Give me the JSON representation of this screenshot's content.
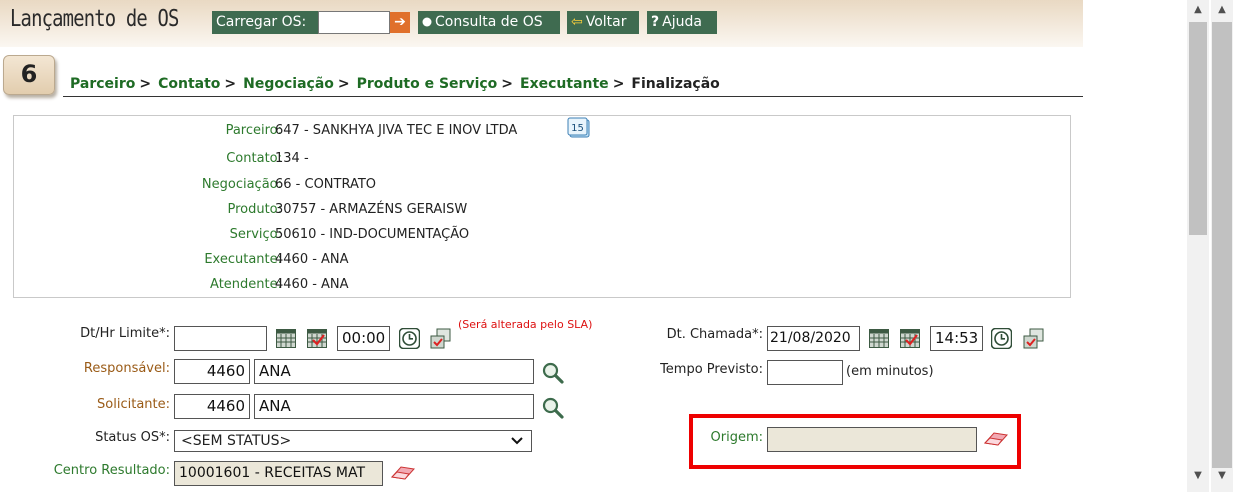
{
  "header": {
    "title": "Lançamento de OS",
    "load_label": "Carregar OS:",
    "load_value": "",
    "consult_label": "Consulta de OS",
    "back_label": "Voltar",
    "help_label": "Ajuda"
  },
  "step": {
    "number": "6"
  },
  "breadcrumb": {
    "items": [
      "Parceiro",
      "Contato",
      "Negociação",
      "Produto e Serviço",
      "Executante"
    ],
    "current": "Finalização",
    "separator": ">"
  },
  "summary": {
    "rows": [
      {
        "label": "Parceiro:",
        "value": "647 - SANKHYA JIVA TEC E INOV LTDA"
      },
      {
        "label": "Contato:",
        "value": "134 -"
      },
      {
        "label": "Negociação:",
        "value": "66 - CONTRATO"
      },
      {
        "label": "Produto:",
        "value": "30757 - ARMAZÉNS GERAISW"
      },
      {
        "label": "Serviço:",
        "value": "50610 - IND-DOCUMENTAÇÃO"
      },
      {
        "label": "Executante:",
        "value": "4460 - ANA"
      },
      {
        "label": "Atendente:",
        "value": "4460 - ANA"
      }
    ],
    "calendar_badge": "15"
  },
  "form": {
    "dt_limite_label": "Dt/Hr Limite*:",
    "dt_limite_value": "",
    "dt_limite_time": "00:00",
    "sla_note": "(Será alterada pelo SLA)",
    "responsavel_label": "Responsável:",
    "responsavel_code": "4460",
    "responsavel_name": "ANA",
    "solicitante_label": "Solicitante:",
    "solicitante_code": "4460",
    "solicitante_name": "ANA",
    "status_label": "Status OS*:",
    "status_value": "<SEM STATUS>",
    "centro_label": "Centro Resultado:",
    "centro_value": "10001601 - RECEITAS MAT",
    "dt_chamada_label": "Dt. Chamada*:",
    "dt_chamada_value": "21/08/2020",
    "dt_chamada_time": "14:53",
    "tempo_label": "Tempo Previsto:",
    "tempo_value": "",
    "tempo_unit": "(em minutos)",
    "origem_label": "Origem:",
    "origem_value": ""
  },
  "colors": {
    "toolbar_bg": "#3f6b50",
    "link_green": "#1e6b24",
    "label_green": "#2d7a2d",
    "label_brown": "#9a5b17",
    "highlight_red": "#ee0000"
  }
}
